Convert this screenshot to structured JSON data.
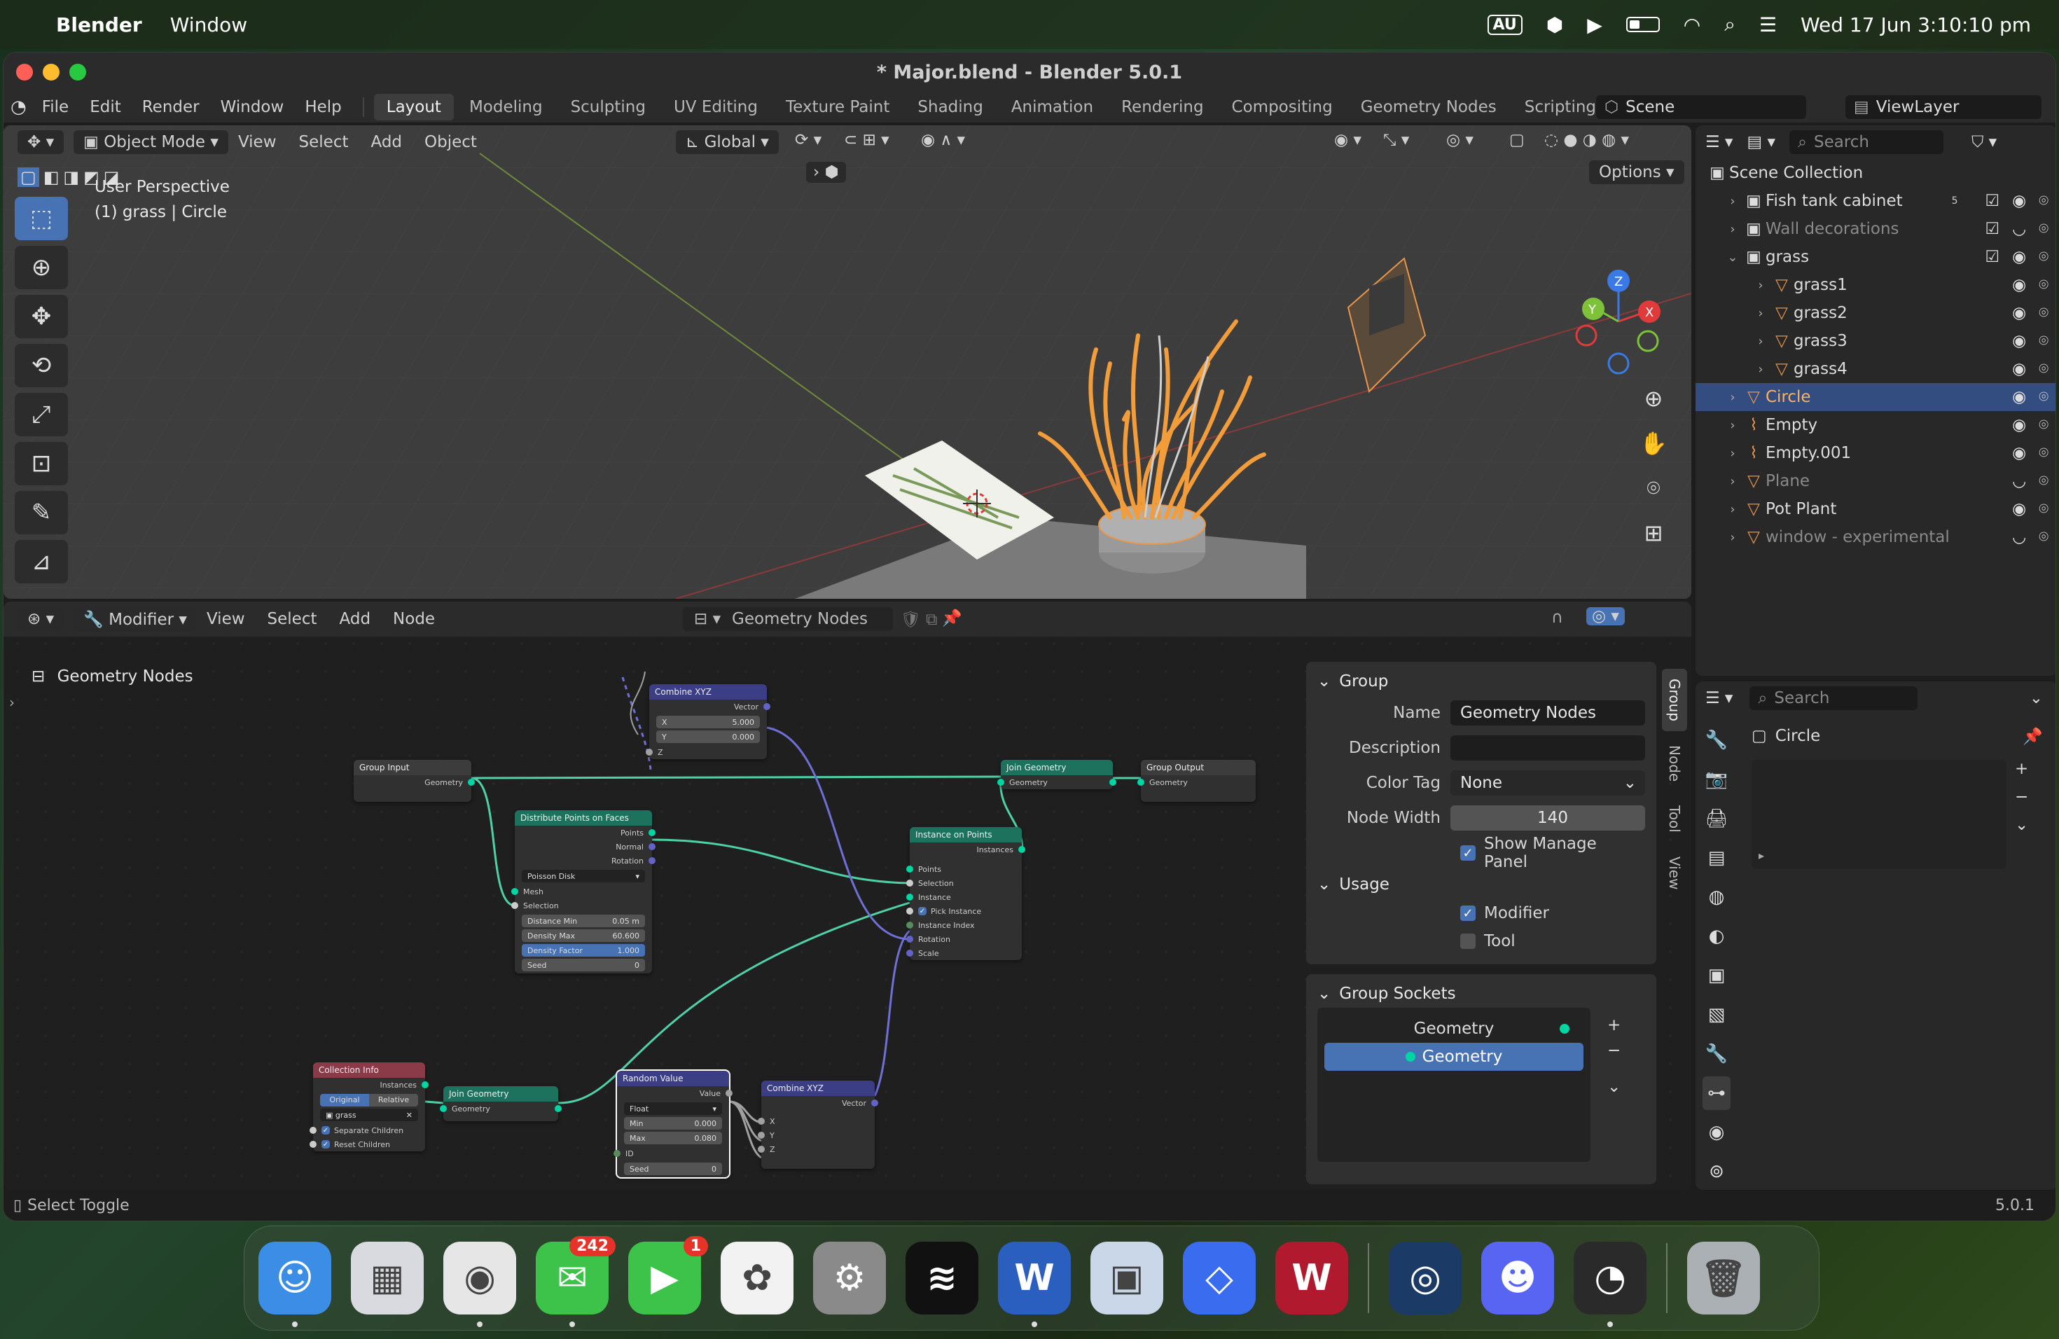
{
  "menubar": {
    "app_name": "Blender",
    "items": [
      "Window"
    ],
    "input_source": "AU",
    "datetime": "Wed 17 Jun  3:10:10 pm"
  },
  "window": {
    "title": "* Major.blend - Blender 5.0.1"
  },
  "topbar": {
    "menus": [
      "File",
      "Edit",
      "Render",
      "Window",
      "Help"
    ],
    "workspaces": [
      "Layout",
      "Modeling",
      "Sculpting",
      "UV Editing",
      "Texture Paint",
      "Shading",
      "Animation",
      "Rendering",
      "Compositing",
      "Geometry Nodes",
      "Scripting"
    ],
    "active_workspace": "Layout",
    "scene": "Scene",
    "view_layer": "ViewLayer"
  },
  "viewport": {
    "mode": "Object Mode",
    "menus": [
      "View",
      "Select",
      "Add",
      "Object"
    ],
    "transform_orientation": "Global",
    "options_label": "Options",
    "info_line1": "User Perspective",
    "info_line2": "(1) grass | Circle",
    "gizmo_axes": [
      "X",
      "Y",
      "Z"
    ]
  },
  "node_editor": {
    "editor_type": "Modifier",
    "menus": [
      "View",
      "Select",
      "Add",
      "Node"
    ],
    "tree_name": "Geometry Nodes",
    "breadcrumb": "Geometry Nodes",
    "nodes": {
      "combine_xyz_top": {
        "title": "Combine XYZ",
        "out": "Vector",
        "x_label": "X",
        "x_val": "5.000",
        "y_label": "Y",
        "y_val": "0.000",
        "z_label": "Z"
      },
      "group_input": {
        "title": "Group Input",
        "out": "Geometry"
      },
      "join_geometry_top": {
        "title": "Join Geometry",
        "in": "Geometry"
      },
      "group_output": {
        "title": "Group Output",
        "in": "Geometry"
      },
      "distribute": {
        "title": "Distribute Points on Faces",
        "outs": [
          "Points",
          "Normal",
          "Rotation"
        ],
        "mode": "Poisson Disk",
        "ins": [
          "Mesh",
          "Selection"
        ],
        "dist_min_label": "Distance Min",
        "dist_min": "0.05 m",
        "density_max_label": "Density Max",
        "density_max": "60.600",
        "density_factor_label": "Density Factor",
        "density_factor": "1.000",
        "seed_label": "Seed",
        "seed": "0"
      },
      "instance_on_points": {
        "title": "Instance on Points",
        "out": "Instances",
        "ins": [
          "Points",
          "Selection",
          "Instance"
        ],
        "pick_instance": "Pick Instance",
        "ins2": [
          "Instance Index",
          "Rotation",
          "Scale"
        ]
      },
      "collection_info": {
        "title": "Collection Info",
        "out": "Instances",
        "toggle_a": "Original",
        "toggle_b": "Relative",
        "collection": "grass",
        "separate_children": "Separate Children",
        "reset_children": "Reset Children"
      },
      "join_geometry_bottom": {
        "title": "Join Geometry",
        "in": "Geometry"
      },
      "random_value": {
        "title": "Random Value",
        "out": "Value",
        "type": "Float",
        "min_label": "Min",
        "min": "0.000",
        "max_label": "Max",
        "max": "0.080",
        "id_label": "ID",
        "seed_label": "Seed",
        "seed": "0"
      },
      "combine_xyz_bottom": {
        "title": "Combine XYZ",
        "out": "Vector",
        "ins": [
          "X",
          "Y",
          "Z"
        ]
      }
    }
  },
  "npanel": {
    "tabs": [
      "Group",
      "Node",
      "Tool",
      "View"
    ],
    "group_title": "Group",
    "name_label": "Name",
    "name_value": "Geometry Nodes",
    "description_label": "Description",
    "description_value": "",
    "color_tag_label": "Color Tag",
    "color_tag_value": "None",
    "node_width_label": "Node Width",
    "node_width_value": "140",
    "show_manage_panel": "Show Manage Panel",
    "usage_title": "Usage",
    "usage_modifier": "Modifier",
    "usage_tool": "Tool",
    "sockets_title": "Group Sockets",
    "sockets": [
      "Geometry",
      "Geometry"
    ]
  },
  "outliner": {
    "search_placeholder": "Search",
    "root": "Scene Collection",
    "rows": [
      {
        "name": "Fish tank cabinet",
        "type": "collection",
        "dim": false,
        "sel": false,
        "indent": 1,
        "count": "5"
      },
      {
        "name": "Wall decorations",
        "type": "collection",
        "dim": true,
        "sel": false,
        "indent": 1,
        "count": ""
      },
      {
        "name": "grass",
        "type": "collection",
        "dim": false,
        "sel": false,
        "indent": 1,
        "count": ""
      },
      {
        "name": "grass1",
        "type": "mesh",
        "dim": false,
        "sel": false,
        "indent": 2,
        "count": ""
      },
      {
        "name": "grass2",
        "type": "mesh",
        "dim": false,
        "sel": false,
        "indent": 2,
        "count": ""
      },
      {
        "name": "grass3",
        "type": "mesh",
        "dim": false,
        "sel": false,
        "indent": 2,
        "count": ""
      },
      {
        "name": "grass4",
        "type": "mesh",
        "dim": false,
        "sel": false,
        "indent": 2,
        "count": ""
      },
      {
        "name": "Circle",
        "type": "mesh",
        "dim": false,
        "sel": true,
        "indent": 1,
        "count": ""
      },
      {
        "name": "Empty",
        "type": "empty",
        "dim": false,
        "sel": false,
        "indent": 1,
        "count": ""
      },
      {
        "name": "Empty.001",
        "type": "empty",
        "dim": false,
        "sel": false,
        "indent": 1,
        "count": ""
      },
      {
        "name": "Plane",
        "type": "mesh",
        "dim": true,
        "sel": false,
        "indent": 1,
        "count": ""
      },
      {
        "name": "Pot Plant",
        "type": "mesh",
        "dim": false,
        "sel": false,
        "indent": 1,
        "count": ""
      },
      {
        "name": "window - experimental",
        "type": "mesh",
        "dim": true,
        "sel": false,
        "indent": 1,
        "count": ""
      }
    ]
  },
  "properties": {
    "search_placeholder": "Search",
    "object_name": "Circle"
  },
  "statusbar": {
    "left": "Select Toggle",
    "version": "5.0.1"
  },
  "dock": {
    "apps": [
      {
        "name": "Finder",
        "badge": "",
        "color": "#3b8de6",
        "glyph": "☺",
        "running": true
      },
      {
        "name": "Launchpad",
        "badge": "",
        "color": "#d9d9e0",
        "glyph": "▦",
        "running": false
      },
      {
        "name": "Chrome",
        "badge": "",
        "color": "#e6e6e6",
        "glyph": "◉",
        "running": true
      },
      {
        "name": "Messages",
        "badge": "242",
        "color": "#3ec34a",
        "glyph": "✉",
        "running": true
      },
      {
        "name": "FaceTime",
        "badge": "1",
        "color": "#3ec34a",
        "glyph": "▶",
        "running": false
      },
      {
        "name": "Photos",
        "badge": "",
        "color": "#f2f2f2",
        "glyph": "✿",
        "running": false
      },
      {
        "name": "System Settings",
        "badge": "",
        "color": "#8a8a8a",
        "glyph": "⚙",
        "running": false
      },
      {
        "name": "Spotify",
        "badge": "",
        "color": "#111111",
        "glyph": "≋",
        "running": false
      },
      {
        "name": "Word",
        "badge": "",
        "color": "#2b5fbf",
        "glyph": "W",
        "running": true
      },
      {
        "name": "Preview",
        "badge": "",
        "color": "#c9d7e8",
        "glyph": "▣",
        "running": false
      },
      {
        "name": "Roblox",
        "badge": "",
        "color": "#3a6cf0",
        "glyph": "◇",
        "running": false
      },
      {
        "name": "WPS",
        "badge": "",
        "color": "#b11a2e",
        "glyph": "W",
        "running": false
      },
      {
        "name": "Steam",
        "badge": "",
        "color": "#1b3a66",
        "glyph": "◎",
        "running": false
      },
      {
        "name": "Discord",
        "badge": "",
        "color": "#5865f2",
        "glyph": "☻",
        "running": false
      },
      {
        "name": "Blender",
        "badge": "",
        "color": "#2a2a2a",
        "glyph": "◔",
        "running": true
      },
      {
        "name": "Trash",
        "badge": "",
        "color": "#aab0b4",
        "glyph": "🗑",
        "running": false
      }
    ]
  }
}
